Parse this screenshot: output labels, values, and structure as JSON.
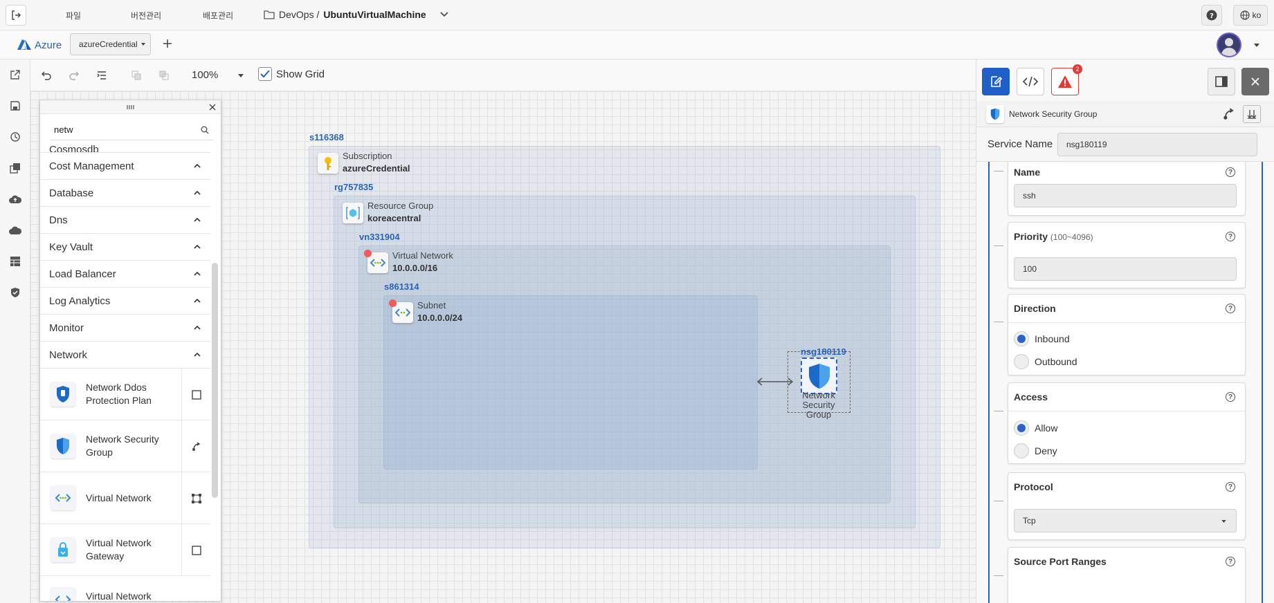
{
  "topbar": {
    "menu": [
      "파일",
      "버전관리",
      "배포관리"
    ],
    "project_folder": "DevOps /",
    "project_name": "UbuntuVirtualMachine",
    "lang": "ko"
  },
  "bar2": {
    "brand": "Azure",
    "tab_label": "azureCredential"
  },
  "toolbar": {
    "zoom": "100%",
    "show_grid_label": "Show Grid",
    "show_grid_checked": true
  },
  "palette": {
    "search_value": "netw",
    "categories": [
      "Cosmosdb",
      "Cost Management",
      "Database",
      "Dns",
      "Key Vault",
      "Load Balancer",
      "Log Analytics",
      "Monitor",
      "Network"
    ],
    "services": [
      {
        "label": "Network Ddos Protection Plan",
        "icon": "ddos-shield-icon"
      },
      {
        "label": "Network Security Group",
        "icon": "nsg-shield-icon"
      },
      {
        "label": "Virtual Network",
        "icon": "vnet-icon"
      },
      {
        "label": "Virtual Network Gateway",
        "icon": "vnet-gateway-icon"
      },
      {
        "label": "Virtual Network",
        "icon": "vnet-icon"
      }
    ]
  },
  "diagram": {
    "subscription": {
      "id": "s116368",
      "type": "Subscription",
      "name": "azureCredential"
    },
    "resource_group": {
      "id": "rg757835",
      "type": "Resource Group",
      "name": "koreacentral"
    },
    "vnet": {
      "id": "vn331904",
      "type": "Virtual Network",
      "cidr": "10.0.0.0/16"
    },
    "subnet": {
      "id": "s861314",
      "type": "Subnet",
      "cidr": "10.0.0.0/24"
    },
    "nsg": {
      "id": "nsg180119",
      "label": "Network Security Group"
    }
  },
  "rpanel": {
    "alert_count": "2",
    "resource_type": "Network Security Group",
    "service_name_label": "Service Name",
    "service_name_value": "nsg180119",
    "name_label": "Name",
    "name_value": "ssh",
    "priority_label": "Priority",
    "priority_hint": "(100~4096)",
    "priority_value": "100",
    "direction_label": "Direction",
    "direction_options": [
      "Inbound",
      "Outbound"
    ],
    "access_label": "Access",
    "access_options": [
      "Allow",
      "Deny"
    ],
    "protocol_label": "Protocol",
    "protocol_value": "Tcp",
    "source_port_label": "Source Port Ranges"
  },
  "colors": {
    "accent": "#2a62c9",
    "alert": "#e53935",
    "id_text": "#2b63b5"
  }
}
